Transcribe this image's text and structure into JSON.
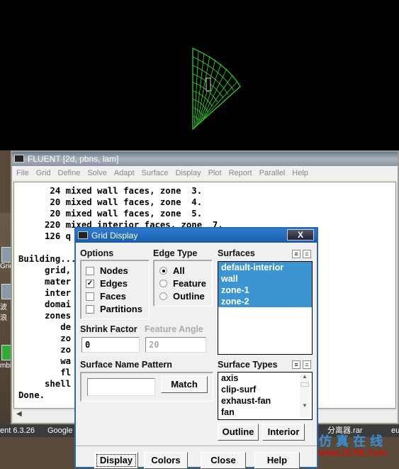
{
  "fluent_window": {
    "title": "FLUENT  [2d, pbns, lam]",
    "menu": [
      "File",
      "Grid",
      "Define",
      "Solve",
      "Adapt",
      "Surface",
      "Display",
      "Plot",
      "Report",
      "Parallel",
      "Help"
    ],
    "console_lines": [
      "      24 mixed wall faces, zone  3.",
      "      20 mixed wall faces, zone  4.",
      "      20 mixed wall faces, zone  5.",
      "     220 mixed interior faces, zone  7.",
      "     126 q",
      "",
      "Building...",
      "     grid,",
      "     mater",
      "     inter",
      "     domai",
      "     zones",
      "        de",
      "        zo",
      "        zo",
      "        wa",
      "        fl",
      "     shell",
      "Done."
    ]
  },
  "desktop": {
    "labels": [
      "Gric",
      "波浪",
      "mbi"
    ]
  },
  "taskbar": {
    "items": [
      "ent 6.3.26",
      "Google",
      "分离器.rar",
      "eu"
    ]
  },
  "watermark": {
    "cn": "仿真在线",
    "url": "www.1CAE.com"
  },
  "dialog": {
    "title": "Grid Display",
    "close": "X",
    "options": {
      "label": "Options",
      "items": [
        {
          "label": "Nodes",
          "checked": false
        },
        {
          "label": "Edges",
          "checked": true
        },
        {
          "label": "Faces",
          "checked": false
        },
        {
          "label": "Partitions",
          "checked": false
        }
      ]
    },
    "edge_type": {
      "label": "Edge Type",
      "items": [
        {
          "label": "All",
          "selected": true
        },
        {
          "label": "Feature",
          "selected": false
        },
        {
          "label": "Outline",
          "selected": false
        }
      ]
    },
    "surfaces": {
      "label": "Surfaces",
      "items": [
        "default-interior",
        "wall",
        "zone-1",
        "zone-2"
      ],
      "selected": [
        "default-interior",
        "wall",
        "zone-1",
        "zone-2"
      ]
    },
    "shrink_factor": {
      "label": "Shrink Factor",
      "value": "0"
    },
    "feature_angle": {
      "label": "Feature Angle",
      "value": "20"
    },
    "pattern": {
      "label": "Surface Name Pattern",
      "value": "",
      "match": "Match"
    },
    "surface_types": {
      "label": "Surface Types",
      "items": [
        "axis",
        "clip-surf",
        "exhaust-fan",
        "fan"
      ]
    },
    "outline": "Outline",
    "interior": "Interior",
    "buttons": [
      "Display",
      "Colors",
      "Close",
      "Help"
    ],
    "select_all_icon": "select-all",
    "deselect_all_icon": "deselect-all"
  }
}
